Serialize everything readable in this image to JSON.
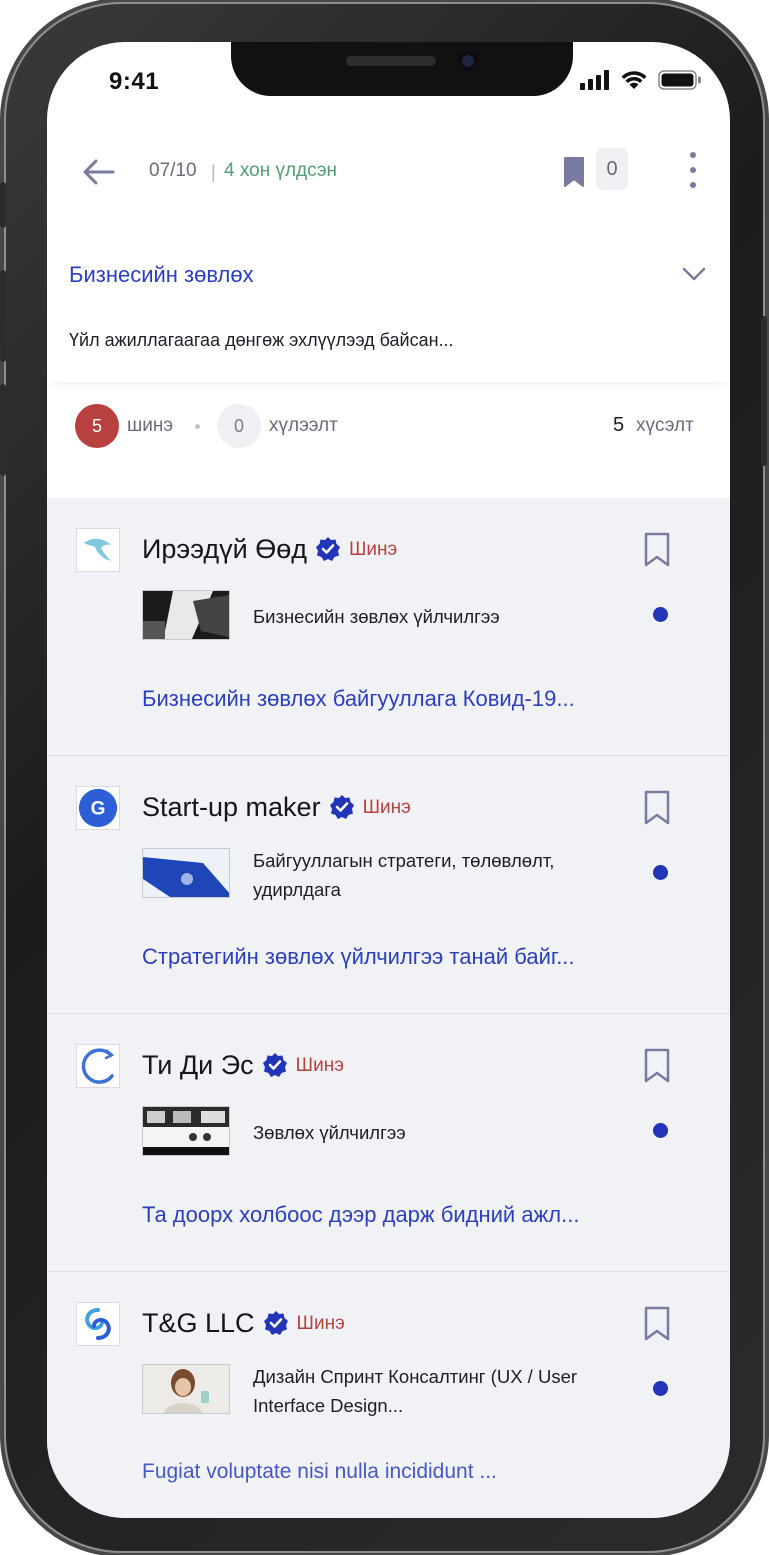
{
  "status_bar": {
    "time": "9:41"
  },
  "header": {
    "counter": "07/10",
    "separator": "|",
    "remaining": "4 хон үлдсэн",
    "bookmark_count": "0"
  },
  "category": {
    "title": "Бизнесийн зөвлөх",
    "description": "Үйл ажиллагаагаа дөнгөж эхлүүлээд байсан..."
  },
  "stats": {
    "new_count": "5",
    "new_label": "шинэ",
    "waiting_count": "0",
    "waiting_label": "хүлээлт",
    "wish_count": "5",
    "wish_label": "хүсэлт"
  },
  "colors": {
    "accent_blue": "#2b3fbf",
    "new_red": "#b8403f",
    "remaining_green": "#4f9f73",
    "list_background": "#f1f2f6"
  },
  "items": [
    {
      "company": "Ирээдүй Өөд",
      "verified_icon": "verified-badge-icon",
      "tag": "Шинэ",
      "service": "Бизнесийн зөвлөх үйлчилгээ",
      "link": "Бизнесийн зөвлөх байгууллага Ковид-19..."
    },
    {
      "company": "Start-up maker",
      "verified_icon": "verified-badge-icon",
      "tag": "Шинэ",
      "service": "Байгууллагын стратеги, төлөвлөлт, удирлдага",
      "link": "Стратегийн зөвлөх үйлчилгээ танай  байг..."
    },
    {
      "company": "Ти Ди Эс",
      "verified_icon": "verified-badge-icon",
      "tag": "Шинэ",
      "service": "Зөвлөх үйлчилгээ",
      "link": "Та доорх холбоос дээр дарж бидний ажл..."
    },
    {
      "company": "T&G LLC",
      "verified_icon": "verified-badge-icon",
      "tag": "Шинэ",
      "service": "Дизайн Спринт Консалтинг (UX / User Interface Design...",
      "link": "Fugiat voluptate nisi nulla incididunt ..."
    }
  ]
}
